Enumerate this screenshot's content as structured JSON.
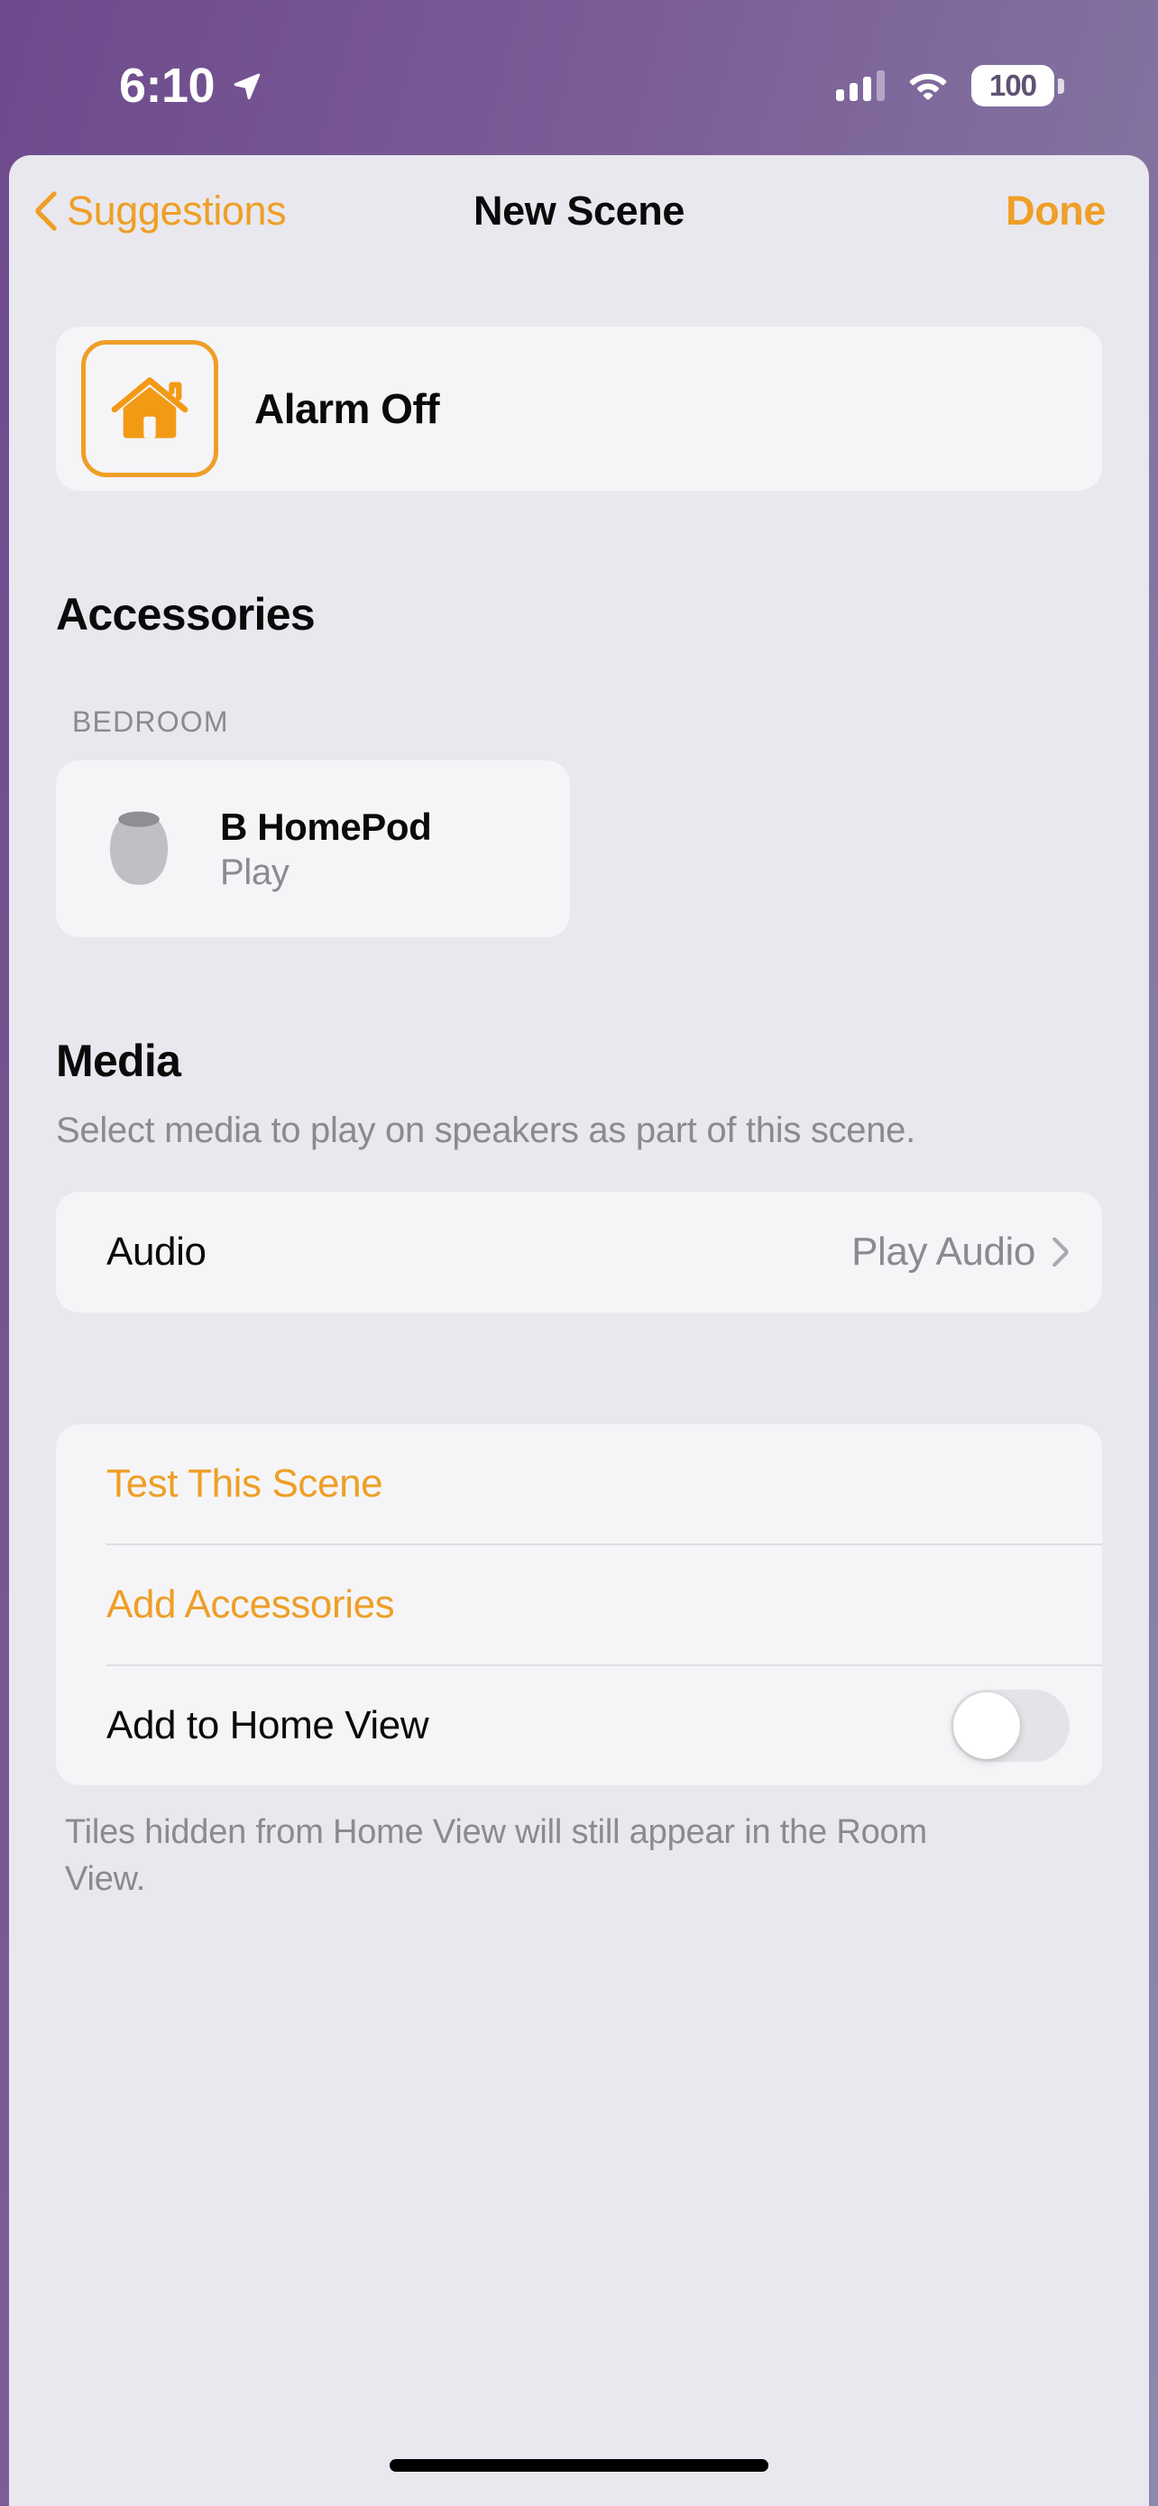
{
  "status_bar": {
    "time": "6:10",
    "location_icon": "location-arrow-icon",
    "cellular_icon": "cellular-bars-icon",
    "cellular_bars_filled": 3,
    "cellular_bars_total": 4,
    "wifi_icon": "wifi-icon",
    "battery_percent": "100",
    "battery_icon": "battery-icon"
  },
  "nav": {
    "back_icon": "chevron-left-icon",
    "back_label": "Suggestions",
    "title": "New Scene",
    "done_label": "Done"
  },
  "scene": {
    "icon": "house-icon",
    "name": "Alarm Off"
  },
  "accessories": {
    "title": "Accessories",
    "group_label": "BEDROOM",
    "items": [
      {
        "icon": "homepod-icon",
        "name": "B HomePod",
        "state": "Play"
      }
    ]
  },
  "media": {
    "title": "Media",
    "subtitle": "Select media to play on speakers as part of this scene.",
    "rows": [
      {
        "label": "Audio",
        "value": "Play Audio",
        "accessory_icon": "chevron-right-icon"
      }
    ]
  },
  "actions": {
    "test_scene_label": "Test This Scene",
    "add_accessories_label": "Add Accessories",
    "add_to_home_view_label": "Add to Home View",
    "add_to_home_view_enabled": false,
    "footnote": "Tiles hidden from Home View will still appear in the Room View."
  },
  "colors": {
    "accent": "#EE9F27",
    "background": "#E9E8EE",
    "card": "#F5F5F7",
    "secondary_text": "#8A8A90",
    "primary_text": "#0A0A0A"
  }
}
